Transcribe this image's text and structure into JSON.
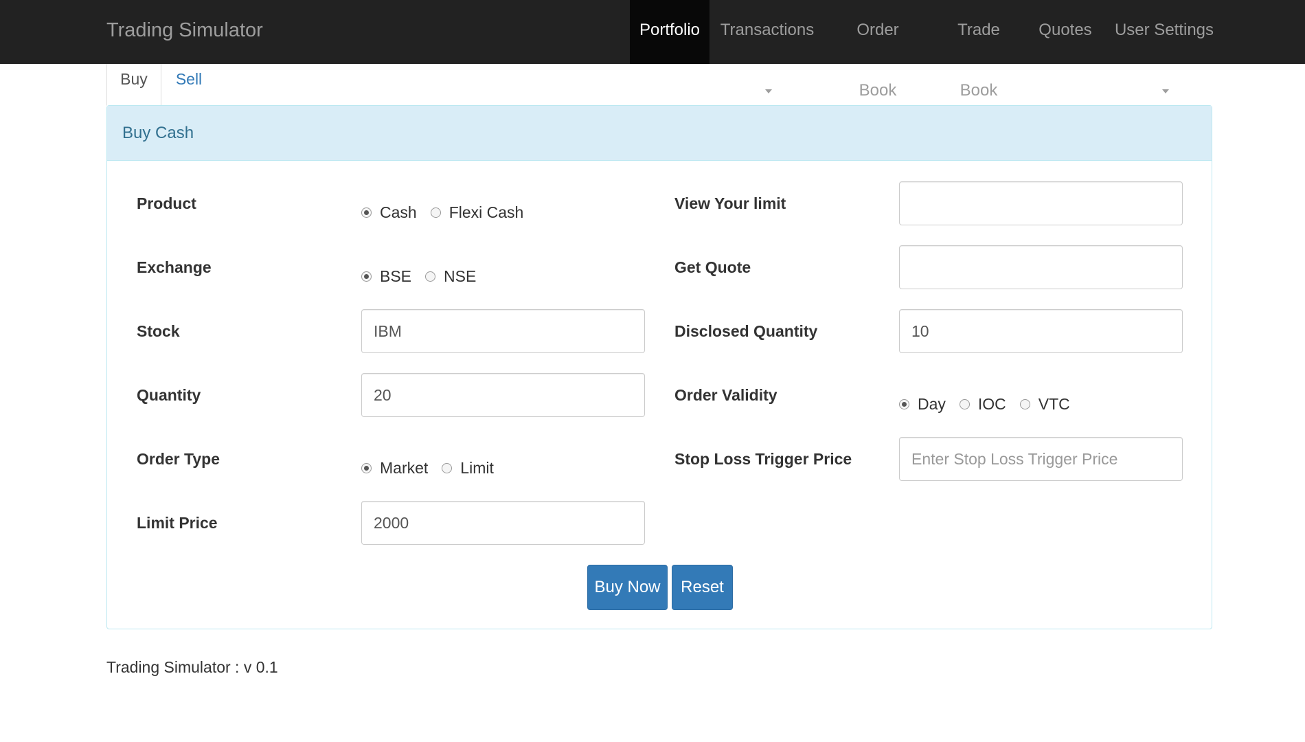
{
  "navbar": {
    "brand": "Trading Simulator",
    "items": [
      {
        "label": "Portfolio",
        "active": true
      },
      {
        "label": "Transactions",
        "dropdown": true
      },
      {
        "label": "Order Book"
      },
      {
        "label": "Trade Book"
      },
      {
        "label": "Quotes"
      },
      {
        "label": "User Settings",
        "dropdown": true
      }
    ]
  },
  "tabs": [
    {
      "label": "Buy",
      "active": true
    },
    {
      "label": "Sell",
      "active": false
    }
  ],
  "panel": {
    "heading": "Buy Cash"
  },
  "form": {
    "product": {
      "label": "Product",
      "options": [
        "Cash",
        "Flexi Cash"
      ],
      "selected": "Cash"
    },
    "exchange": {
      "label": "Exchange",
      "options": [
        "BSE",
        "NSE"
      ],
      "selected": "BSE"
    },
    "stock": {
      "label": "Stock",
      "value": "IBM"
    },
    "quantity": {
      "label": "Quantity",
      "value": "20"
    },
    "order_type": {
      "label": "Order Type",
      "options": [
        "Market",
        "Limit"
      ],
      "selected": "Market"
    },
    "limit_price": {
      "label": "Limit Price",
      "value": "2000"
    },
    "view_limit": {
      "label": "View Your limit",
      "value": ""
    },
    "get_quote": {
      "label": "Get Quote",
      "value": ""
    },
    "disclosed_quantity": {
      "label": "Disclosed Quantity",
      "value": "10"
    },
    "order_validity": {
      "label": "Order Validity",
      "options": [
        "Day",
        "IOC",
        "VTC"
      ],
      "selected": "Day"
    },
    "stop_loss": {
      "label": "Stop Loss Trigger Price",
      "value": "",
      "placeholder": "Enter Stop Loss Trigger Price"
    }
  },
  "buttons": {
    "buy_now": "Buy Now",
    "reset": "Reset"
  },
  "footer": {
    "text": "Trading Simulator : v 0.1"
  },
  "colors": {
    "navbar_bg": "#222222",
    "navbar_active_bg": "#080808",
    "panel_heading_bg": "#d9edf7",
    "primary": "#337ab7",
    "link": "#337ab7"
  }
}
